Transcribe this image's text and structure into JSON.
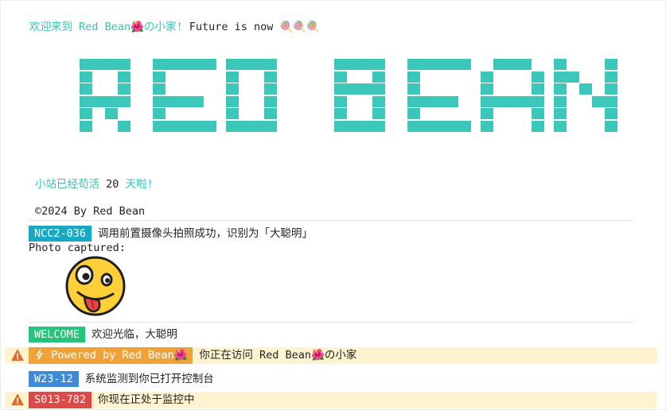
{
  "header": {
    "welcome_prefix": "欢迎来到 Red Bean",
    "flower_emoji": "🌺",
    "welcome_suffix": "の小家!",
    "tagline": "Future is now",
    "lollipop_emoji": "🍭🍭🍭"
  },
  "banner": {
    "text": "RED BEAN",
    "color": "#3cc7bb"
  },
  "uptime": {
    "prefix": "小站已经苟活",
    "days": "20",
    "suffix": "天啦!"
  },
  "footer": {
    "copyright": "©2024 By Red Bean"
  },
  "console": {
    "entries": [
      {
        "badge": "NCC2-036",
        "badge_color": "#17a9c2",
        "message": "调用前置摄像头拍照成功，识别为「大聪明」"
      },
      {
        "label": "Photo captured:",
        "icon": "crazy-face-emoji"
      },
      {
        "badge": "WELCOME",
        "badge_color": "#27c27b",
        "message": "欢迎光临，大聪明"
      },
      {
        "level": "warning",
        "badge_icon": "lightning-icon",
        "badge": "Powered by Red Bean🌺",
        "badge_color": "#f0a236",
        "message": "你正在访问 Red Bean🌺の小家"
      },
      {
        "badge": "W23-12",
        "badge_color": "#3e8ad6",
        "message": "系统监测到你已打开控制台"
      },
      {
        "level": "warning",
        "badge": "S013-782",
        "badge_color": "#db4a48",
        "message": "你现在正处于监控中"
      }
    ]
  }
}
